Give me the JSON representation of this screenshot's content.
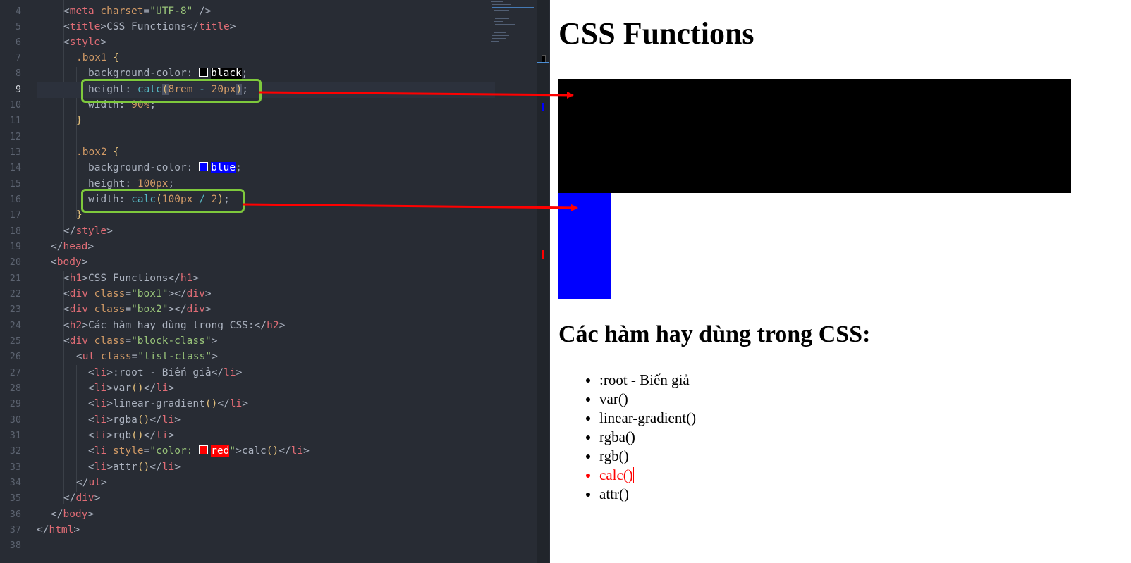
{
  "editor": {
    "line_numbers": [
      "4",
      "5",
      "6",
      "7",
      "8",
      "9",
      "10",
      "11",
      "12",
      "13",
      "14",
      "15",
      "16",
      "17",
      "18",
      "19",
      "20",
      "21",
      "22",
      "23",
      "24",
      "25",
      "26",
      "27",
      "28",
      "29",
      "30",
      "31",
      "32",
      "33",
      "34",
      "35",
      "36",
      "37",
      "38"
    ],
    "current_line": "9",
    "swatch_colors": {
      "black": "#000000",
      "blue": "#0000ff",
      "red": "#ff0000"
    }
  },
  "preview": {
    "h1": "CSS Functions",
    "h2": "Các hàm hay dùng trong CSS:",
    "list": [
      ":root - Biến giả",
      "var()",
      "linear-gradient()",
      "rgba()",
      "rgb()",
      "calc()",
      "attr()"
    ],
    "list_highlight_color": "#ff0000",
    "box1_color": "#000000",
    "box2_color": "#0000ff"
  },
  "annotations": {
    "box_color": "#7ec93c",
    "arrow_color": "#ff0000"
  }
}
